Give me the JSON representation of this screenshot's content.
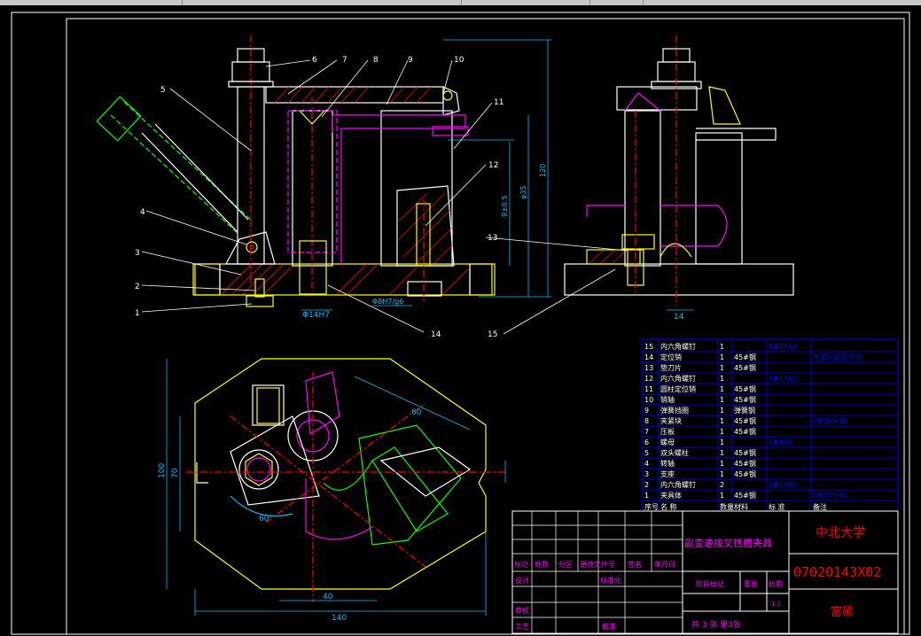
{
  "drawing": {
    "leader_numbers": [
      "1",
      "2",
      "3",
      "4",
      "5",
      "6",
      "7",
      "8",
      "9",
      "10",
      "11",
      "12",
      "13",
      "14",
      "15"
    ],
    "front_dims": {
      "d_small": "Φ14H7",
      "d_large": "Φ8H7/g6",
      "h1": "9±0.5",
      "h2": "φ35",
      "h3": "120"
    },
    "side_dims": {
      "w": "14"
    },
    "plan_dims": {
      "w_inner": "40",
      "w_outer": "140",
      "h_inner": "70",
      "h_outer": "100",
      "angle": "60°",
      "diag": "60"
    }
  },
  "parts_list": {
    "rows": [
      {
        "no": "15",
        "name": "内六角螺钉",
        "qty": "1",
        "mat": "",
        "std": "GB1760",
        "note": ""
      },
      {
        "no": "14",
        "name": "定位销",
        "qty": "1",
        "mat": "45#钢",
        "std": "",
        "note": "与盖尺配合可刀"
      },
      {
        "no": "13",
        "name": "垫刀片",
        "qty": "1",
        "mat": "45#钢",
        "std": "",
        "note": ""
      },
      {
        "no": "12",
        "name": "内六角螺钉",
        "qty": "1",
        "mat": "",
        "std": "GB1760",
        "note": ""
      },
      {
        "no": "11",
        "name": "圆柱定位销",
        "qty": "1",
        "mat": "45#钢",
        "std": "",
        "note": ""
      },
      {
        "no": "10",
        "name": "销轴",
        "qty": "1",
        "mat": "45#钢",
        "std": "",
        "note": ""
      },
      {
        "no": "9",
        "name": "弹簧挡圈",
        "qty": "1",
        "mat": "弹簧钢",
        "std": "",
        "note": ""
      },
      {
        "no": "8",
        "name": "夹紧块",
        "qty": "1",
        "mat": "45#钢",
        "std": "",
        "note": "HBS55-65"
      },
      {
        "no": "7",
        "name": "压板",
        "qty": "1",
        "mat": "45#钢",
        "std": "",
        "note": ""
      },
      {
        "no": "6",
        "name": "螺母",
        "qty": "1",
        "mat": "",
        "std": "GB860",
        "note": ""
      },
      {
        "no": "5",
        "name": "双头螺柱",
        "qty": "1",
        "mat": "45#钢",
        "std": "",
        "note": ""
      },
      {
        "no": "4",
        "name": "转轴",
        "qty": "1",
        "mat": "45#钢",
        "std": "",
        "note": ""
      },
      {
        "no": "3",
        "name": "支座",
        "qty": "1",
        "mat": "45#钢",
        "std": "",
        "note": ""
      },
      {
        "no": "2",
        "name": "内六角螺钉",
        "qty": "2",
        "mat": "",
        "std": "GB1760",
        "note": ""
      },
      {
        "no": "1",
        "name": "夹具体",
        "qty": "1",
        "mat": "45#钢",
        "std": "",
        "note": "HBS55-65"
      }
    ],
    "header": [
      "序号",
      "名  称",
      "数量",
      "材料",
      "标  准",
      "备注"
    ]
  },
  "title_block": {
    "drawing_name": "副变速拨叉铣槽夹具",
    "school": "中北大学",
    "drawing_no": "07020143X02",
    "author": "富硕",
    "rev_headers": [
      "标记",
      "处数",
      "分区",
      "更改文件号",
      "签名",
      "年月日"
    ],
    "row_design": "设计",
    "row_std": "标准化",
    "row_check": "审核",
    "row_process": "工艺",
    "row_approve": "批准",
    "stage_label": "阶段标记",
    "weight_label": "重量",
    "scale_label": "比例",
    "scale_value": "1:1",
    "sheets": "共 3 张 第3张"
  }
}
